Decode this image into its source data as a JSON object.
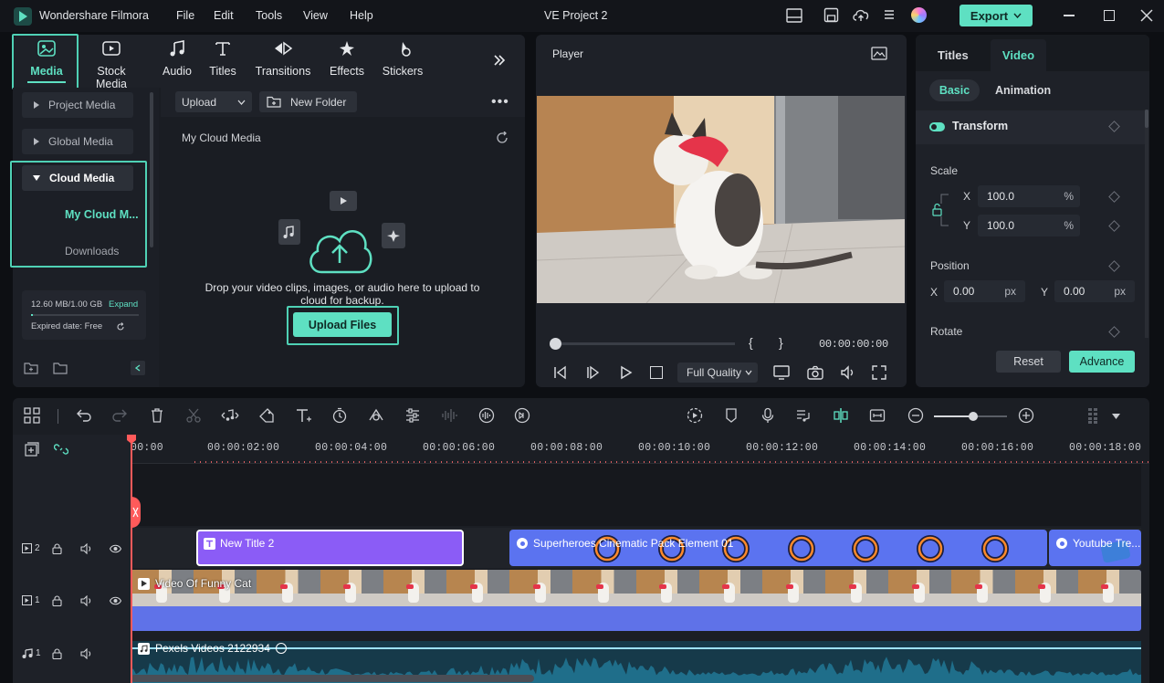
{
  "app": {
    "name": "Wondershare Filmora",
    "menu": [
      "File",
      "Edit",
      "Tools",
      "View",
      "Help"
    ],
    "project_title": "VE Project 2",
    "export_label": "Export"
  },
  "media_tabs": [
    {
      "label": "Media",
      "icon": "media-icon"
    },
    {
      "label": "Stock Media",
      "icon": "stock-media-icon"
    },
    {
      "label": "Audio",
      "icon": "music-note-icon"
    },
    {
      "label": "Titles",
      "icon": "titles-icon"
    },
    {
      "label": "Transitions",
      "icon": "transitions-icon"
    },
    {
      "label": "Effects",
      "icon": "effects-icon"
    },
    {
      "label": "Stickers",
      "icon": "stickers-icon"
    }
  ],
  "sidebar": {
    "items": [
      "Project Media",
      "Global Media",
      "Cloud Media"
    ],
    "sub_items": [
      "My Cloud M...",
      "Downloads"
    ],
    "storage": "12.60 MB/1.00 GB",
    "expand": "Expand",
    "expired": "Expired date: Free"
  },
  "library": {
    "upload": "Upload",
    "new_folder": "New Folder",
    "section_title": "My Cloud Media",
    "drop_text": "Drop your video clips, images, or audio here to upload to cloud for backup.",
    "upload_files": "Upload Files"
  },
  "player": {
    "title": "Player",
    "timecode": "00:00:00:00",
    "quality": "Full Quality",
    "brace_open": "{",
    "brace_close": "}"
  },
  "properties": {
    "tabs": [
      "Titles",
      "Video"
    ],
    "subtabs": [
      "Basic",
      "Animation"
    ],
    "transform": "Transform",
    "scale_label": "Scale",
    "scale_x": "100.0",
    "scale_y": "100.0",
    "percent": "%",
    "position_label": "Position",
    "pos_x": "0.00",
    "pos_y": "0.00",
    "px": "px",
    "rotate_label": "Rotate",
    "x": "X",
    "y": "Y",
    "reset": "Reset",
    "advance": "Advance"
  },
  "timeline": {
    "ruler": [
      "00:00",
      "00:00:02:00",
      "00:00:04:00",
      "00:00:06:00",
      "00:00:08:00",
      "00:00:10:00",
      "00:00:12:00",
      "00:00:14:00",
      "00:00:16:00",
      "00:00:18:00"
    ],
    "tracks": [
      {
        "num": "2"
      },
      {
        "num": "1"
      },
      {
        "num": "1"
      }
    ],
    "clips": {
      "title": "New Title 2",
      "effect": "Superheroes Cinematic Pack Element 01",
      "youtube": "Youtube Tre...",
      "video": "Video Of Funny Cat",
      "audio": "Pexels Videos 2122934"
    }
  },
  "colors": {
    "accent": "#5ee0c2",
    "title_clip": "#8b5cf6",
    "effect_clip": "#5b73f0",
    "audio_wave": "#1f6e8a",
    "playhead": "#ff5a5a"
  }
}
